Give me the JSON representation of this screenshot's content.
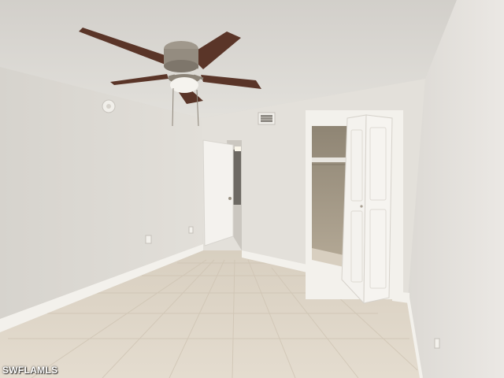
{
  "watermark": "SWFLAMLS",
  "colors": {
    "ceiling": "#dedcd7",
    "wall_left": "#dedbd5",
    "wall_back": "#e4e1db",
    "wall_right": "#e6e3df",
    "floor": "#ddd3c4",
    "baseboard": "#f3f1ec",
    "door": "#f4f2ee",
    "fan_blade": "#5a3528",
    "fan_metal": "#a0988c",
    "closet_interior": "#a89d8b"
  },
  "icons": [
    "ceiling-fan-icon",
    "smoke-detector-icon",
    "air-vent-icon",
    "electrical-outlet-icon"
  ]
}
